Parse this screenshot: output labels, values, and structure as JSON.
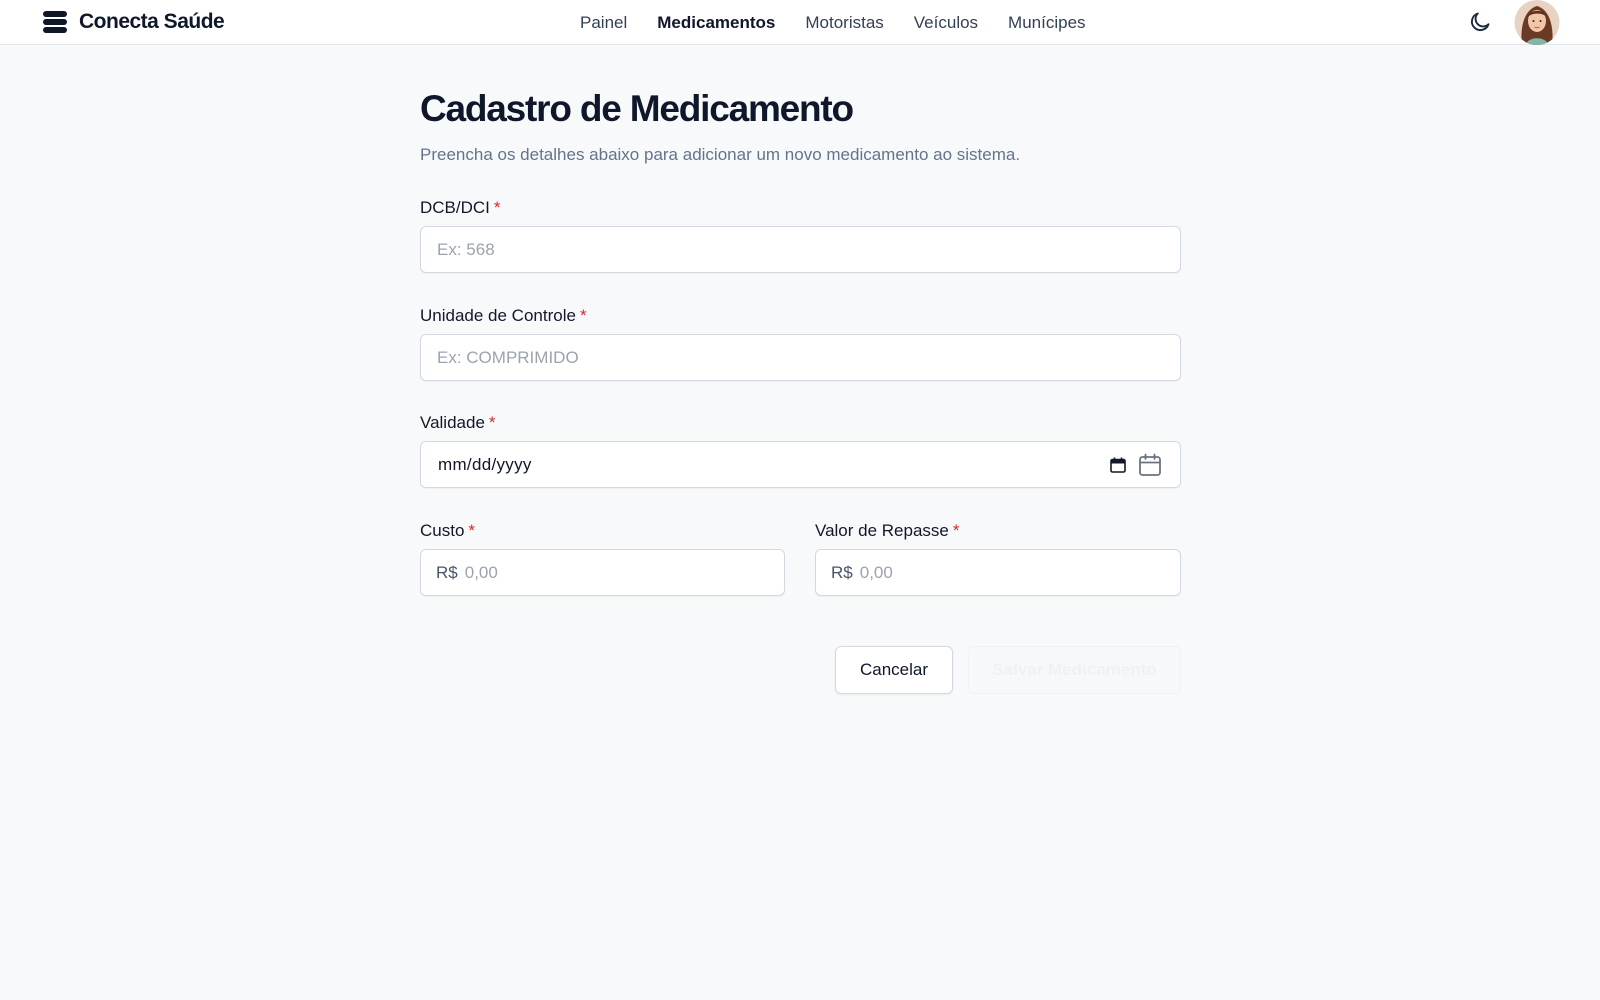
{
  "brand": {
    "name": "Conecta Saúde",
    "logo_icon": "stacked-layers-icon"
  },
  "nav": {
    "items": [
      {
        "label": "Painel",
        "active": false
      },
      {
        "label": "Medicamentos",
        "active": true
      },
      {
        "label": "Motoristas",
        "active": false
      },
      {
        "label": "Veículos",
        "active": false
      },
      {
        "label": "Munícipes",
        "active": false
      }
    ]
  },
  "header": {
    "theme_icon": "moon-icon",
    "avatar_icon": "user-avatar"
  },
  "page": {
    "title": "Cadastro de Medicamento",
    "subtitle": "Preencha os detalhes abaixo para adicionar um novo medicamento ao sistema."
  },
  "form": {
    "required_marker": "*",
    "dcb": {
      "label": "DCB/DCI",
      "placeholder": "Ex: 568",
      "value": ""
    },
    "unidade": {
      "label": "Unidade de Controle",
      "placeholder": "Ex: COMPRIMIDO",
      "value": ""
    },
    "validade": {
      "label": "Validade",
      "display": "mm/dd/yyyy",
      "icon": "calendar-icon"
    },
    "custo": {
      "label": "Custo",
      "prefix": "R$",
      "placeholder": "0,00",
      "value": ""
    },
    "repasse": {
      "label": "Valor de Repasse",
      "prefix": "R$",
      "placeholder": "0,00",
      "value": ""
    }
  },
  "actions": {
    "cancel_label": "Cancelar",
    "save_label": "Salvar Medicamento",
    "save_disabled": true
  },
  "colors": {
    "required": "#dc2626",
    "background": "#f8f9fb",
    "text": "#0f172a",
    "muted": "#64748b"
  }
}
